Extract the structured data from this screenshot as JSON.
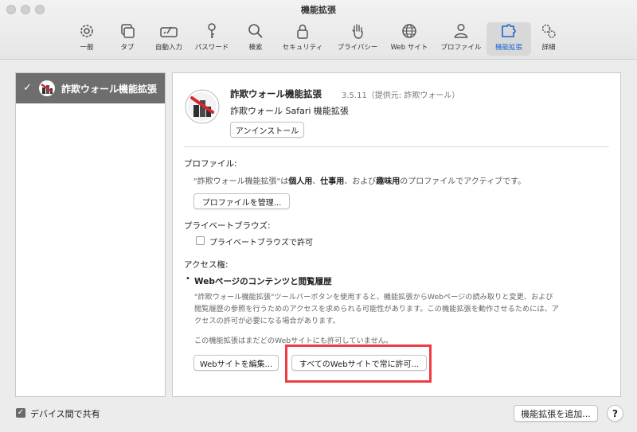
{
  "window": {
    "title": "機能拡張"
  },
  "toolbar": {
    "tabs": [
      {
        "label": "一般",
        "icon": "gear-icon"
      },
      {
        "label": "タブ",
        "icon": "tabs-icon"
      },
      {
        "label": "自動入力",
        "icon": "autofill-icon"
      },
      {
        "label": "パスワード",
        "icon": "key-icon"
      },
      {
        "label": "検索",
        "icon": "search-icon"
      },
      {
        "label": "セキュリティ",
        "icon": "lock-icon"
      },
      {
        "label": "プライバシー",
        "icon": "hand-icon"
      },
      {
        "label": "Web サイト",
        "icon": "globe-icon"
      },
      {
        "label": "プロファイル",
        "icon": "person-icon"
      },
      {
        "label": "機能拡張",
        "icon": "puzzle-icon"
      },
      {
        "label": "詳細",
        "icon": "gears-icon"
      }
    ],
    "active_tab": "機能拡張",
    "accent_color": "#1a64d2"
  },
  "sidebar": {
    "items": [
      {
        "label": "詐欺ウォール機能拡張",
        "checked": true
      }
    ]
  },
  "detail": {
    "ext_name": "詐欺ウォール機能拡張",
    "ext_meta": "3.5.11（提供元: 詐欺ウォール）",
    "ext_sub": "詐欺ウォール Safari 機能拡張",
    "uninstall_label": "アンインストール",
    "profile_heading": "プロファイル:",
    "profile_text_1": "\"詐欺ウォール機能拡張\"は",
    "profile_bold_1": "個人用",
    "profile_sep_1": "、",
    "profile_bold_2": "仕事用",
    "profile_text_2": "、および",
    "profile_bold_3": "趣味用",
    "profile_text_3": "のプロファイルでアクティブです。",
    "manage_profile_label": "プロファイルを管理...",
    "private_heading": "プライベートブラウズ:",
    "private_allow_label": "プライベートブラウズで許可",
    "access_heading": "アクセス権:",
    "access_item_title": "Webページのコンテンツと閲覧履歴",
    "access_desc_line1": "\"詐欺ウォール機能拡張\"ツールバーボタンを使用すると、機能拡張からWebページの読み取りと変更、および",
    "access_desc_line2": "閲覧履歴の参照を行うためのアクセスを求められる可能性があります。この機能拡張を動作させるためには、ア",
    "access_desc_line3": "クセスの許可が必要になる場合があります。",
    "not_allowed_text": "この機能拡張はまだどのWebサイトにも許可していません。",
    "edit_sites_label": "Webサイトを編集...",
    "allow_all_label": "すべてのWebサイトで常に許可..."
  },
  "footer": {
    "share_label": "デバイス間で共有",
    "share_checked": true,
    "add_ext_label": "機能拡張を追加...",
    "help_label": "?"
  },
  "highlight_color": "#ef3b45"
}
